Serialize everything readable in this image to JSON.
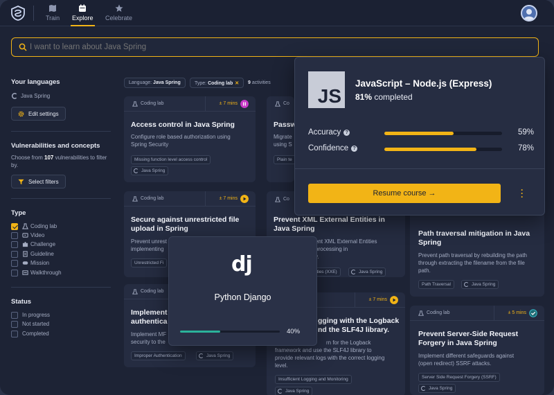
{
  "nav": {
    "items": [
      {
        "label": "Train",
        "icon": "map-icon"
      },
      {
        "label": "Explore",
        "icon": "calendar-icon"
      },
      {
        "label": "Celebrate",
        "icon": "star-icon"
      }
    ],
    "active": "Explore"
  },
  "search": {
    "placeholder": "I want to learn about Java Spring"
  },
  "sidebar": {
    "languages_heading": "Your languages",
    "language": "Java Spring",
    "edit_settings": "Edit settings",
    "vuln_heading": "Vulnerabilities and concepts",
    "vuln_text_pre": "Choose from ",
    "vuln_count": "107",
    "vuln_text_post": " vulnerabilities to filter by.",
    "select_filters": "Select filters",
    "type_heading": "Type",
    "types": [
      {
        "label": "Coding lab",
        "checked": true
      },
      {
        "label": "Video",
        "checked": false
      },
      {
        "label": "Challenge",
        "checked": false
      },
      {
        "label": "Guideline",
        "checked": false
      },
      {
        "label": "Mission",
        "checked": false
      },
      {
        "label": "Walkthrough",
        "checked": false
      }
    ],
    "status_heading": "Status",
    "statuses": [
      {
        "label": "In progress",
        "checked": false
      },
      {
        "label": "Not started",
        "checked": false
      },
      {
        "label": "Completed",
        "checked": false
      }
    ]
  },
  "filters": {
    "language_label": "Language:",
    "language_value": "Java Spring",
    "type_label": "Type:",
    "type_value": "Coding lab",
    "remove": "✕",
    "count": "9",
    "count_label": " activities"
  },
  "cards": [
    {
      "type": "Coding lab",
      "duration": "± 7 mins",
      "title": "Access control in Java Spring",
      "desc": [
        "Configure role based authorization using",
        "Spring Security"
      ],
      "tag": "Missing function level access control",
      "lang": "Java Spring"
    },
    {
      "type": "Co",
      "title": "Passw",
      "desc": [
        "Migrate",
        "using S"
      ],
      "tag": "Plain te"
    },
    {
      "type": "Coding lab",
      "duration": "± 7 mins",
      "title": "Secure against unrestricted file",
      "title2": "upload in Spring",
      "desc": [
        "Prevent unrest",
        "implementing"
      ],
      "tag": "Unrestricted Fi"
    },
    {
      "type": "Co",
      "title": "Prevent XML External Entities in",
      "title2": "Java Spring",
      "desc": [
        "ent XML External Entities",
        "processing in",
        "y."
      ],
      "tag": "ities (XXE)",
      "lang": "Java Spring"
    },
    {
      "type": "Coding lab",
      "title": "Implement",
      "title2": "authentica",
      "desc": [
        "Implement MF",
        "security to the"
      ],
      "tag": "Improper Authentication",
      "lang": "Java Spring"
    },
    {
      "duration": "± 7 mins",
      "title": "gging with the Logback",
      "title2": "nd the SLF4J library.",
      "desc": [
        "rn for the Logback",
        "framework and use the SLF4J library to",
        "provide relevant logs with the correct logging",
        "level."
      ],
      "tag": "Insufficient Logging and Monitoring",
      "lang": "Java Spring"
    },
    {
      "title": "Path traversal mitigation in Java",
      "title2": "Spring",
      "desc": [
        "Prevent path traversal by rebuilding the path",
        "through extracting the filename from the file",
        "path."
      ],
      "tag": "Path Traversal",
      "lang": "Java Spring"
    },
    {
      "type": "Coding lab",
      "duration": "± 5 mins",
      "title": "Prevent Server-Side Request",
      "title2": "Forgery in Java Spring",
      "desc": [
        "Implement different safeguards against",
        "(open redirect) SSRF attacks."
      ],
      "tag": "Server Side Request Forgery (SSRF)",
      "lang": "Java Spring"
    }
  ],
  "js_popup": {
    "logo_text": "JS",
    "title": "JavaScript – Node.js (Express)",
    "completed_pct": "81%",
    "completed_label": " completed",
    "metrics": [
      {
        "label": "Accuracy",
        "value": 0.59,
        "display": "59%"
      },
      {
        "label": "Confidence",
        "value": 0.78,
        "display": "78%"
      }
    ],
    "info_glyph": "?",
    "resume": "Resume course",
    "resume_arrow": "→",
    "accent": "#f2b416"
  },
  "django_popup": {
    "logo_text": "dj",
    "title": "Python Django",
    "progress": 0.4,
    "progress_display": "40%",
    "accent": "#2bb39a"
  }
}
